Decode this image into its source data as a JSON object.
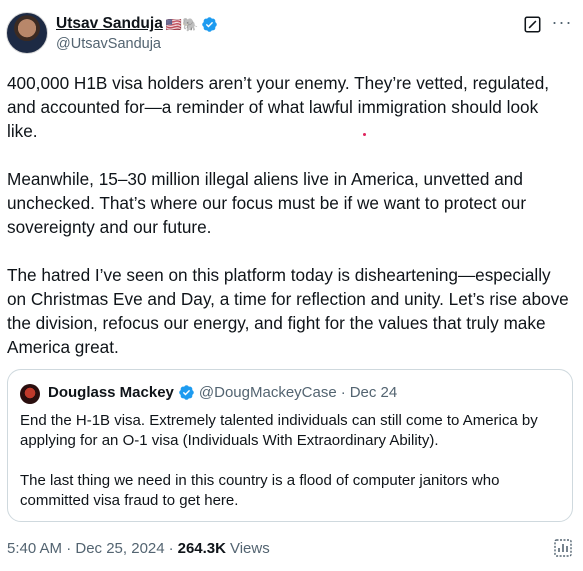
{
  "author": {
    "display_name": "Utsav Sanduja",
    "emojis": "🇺🇸🐘",
    "handle": "@UtsavSanduja"
  },
  "tweet": {
    "paragraphs": [
      "400,000 H1B visa holders aren’t your enemy. They’re vetted, regulated, and accounted for—a reminder of what lawful immigration should look like.",
      "Meanwhile, 15–30 million illegal aliens live in America, unvetted and unchecked. That’s where our focus must be if we want to protect our sovereignty and our future.",
      "The hatred I’ve seen on this platform today is disheartening—especially on Christmas Eve and Day, a time for reflection and unity. Let’s rise above the division, refocus our energy, and fight for the values that truly make America great."
    ]
  },
  "quoted_tweet": {
    "display_name": "Douglass Mackey",
    "handle": "@DougMackeyCase",
    "separator": "·",
    "date": "Dec 24",
    "paragraphs": [
      "End the H-1B visa. Extremely talented individuals can still come to America by applying for an O-1 visa (Individuals With Extraordinary Ability).",
      "The last thing we need in this country is a flood of computer janitors who committed visa fraud to get here."
    ]
  },
  "footer": {
    "timestamp": "5:40 AM · Dec 25, 2024",
    "separator": "·",
    "views_count": "264.3K",
    "views_label": "Views"
  },
  "colors": {
    "verified": "#1d9bf0",
    "secondary_text": "#536471",
    "border": "#cfd9de"
  },
  "icons": [
    "verified-badge-icon",
    "grok-icon",
    "more-icon",
    "analytics-icon"
  ]
}
